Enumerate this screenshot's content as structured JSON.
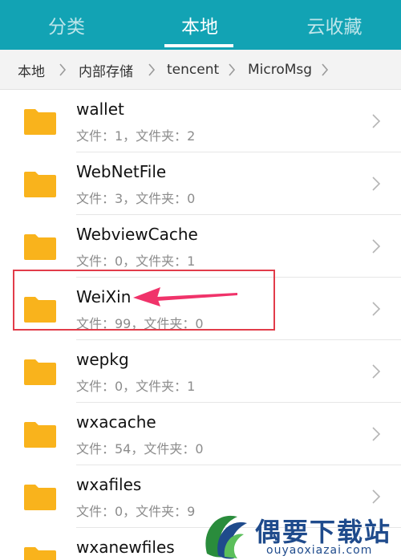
{
  "header": {
    "tabs": [
      {
        "label": "分类",
        "active": false
      },
      {
        "label": "本地",
        "active": true
      },
      {
        "label": "云收藏",
        "active": false
      }
    ],
    "accent_color": "#12a3b4"
  },
  "breadcrumb": {
    "items": [
      "本地",
      "内部存储",
      "tencent",
      "MicroMsg"
    ]
  },
  "files": [
    {
      "name": "wallet",
      "meta": "文件：1，文件夹：2"
    },
    {
      "name": "WebNetFile",
      "meta": "文件：3，文件夹：0"
    },
    {
      "name": "WebviewCache",
      "meta": "文件：0，文件夹：1"
    },
    {
      "name": "WeiXin",
      "meta": "文件：99，文件夹：0",
      "highlighted": true
    },
    {
      "name": "wepkg",
      "meta": "文件：0，文件夹：1"
    },
    {
      "name": "wxacache",
      "meta": "文件：54，文件夹：0"
    },
    {
      "name": "wxafiles",
      "meta": "文件：0，文件夹：9"
    },
    {
      "name": "wxanewfiles",
      "meta": ""
    }
  ],
  "icons": {
    "folder": "folder-icon",
    "chevron": "chevron-right-icon",
    "separator": "breadcrumb-separator-icon"
  },
  "folder_color": "#f9b31c",
  "annotation": {
    "box_color": "#e23c4a",
    "arrow_color": "#f0336a"
  },
  "watermark": {
    "title": "偶要下载站",
    "url": "ouyaoxiazai.com"
  }
}
